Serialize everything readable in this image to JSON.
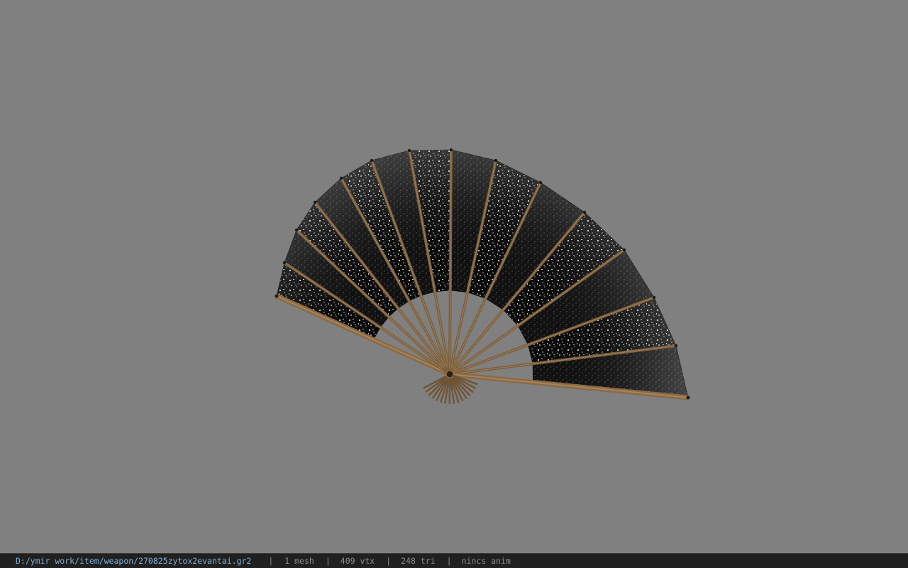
{
  "viewer": {
    "background_color": "#808080",
    "model_name": "folding-fan"
  },
  "statusbar": {
    "file_path": "D:/ymir work/item/weapon/270825zytox2evantai.gr2",
    "separator": "|",
    "mesh_count": "1 mesh",
    "vertex_count": "409 vtx",
    "triangle_count": "248 tri",
    "animation": "nincs anim",
    "path_color": "#7fb0d8",
    "text_color": "#8c8c8c"
  }
}
